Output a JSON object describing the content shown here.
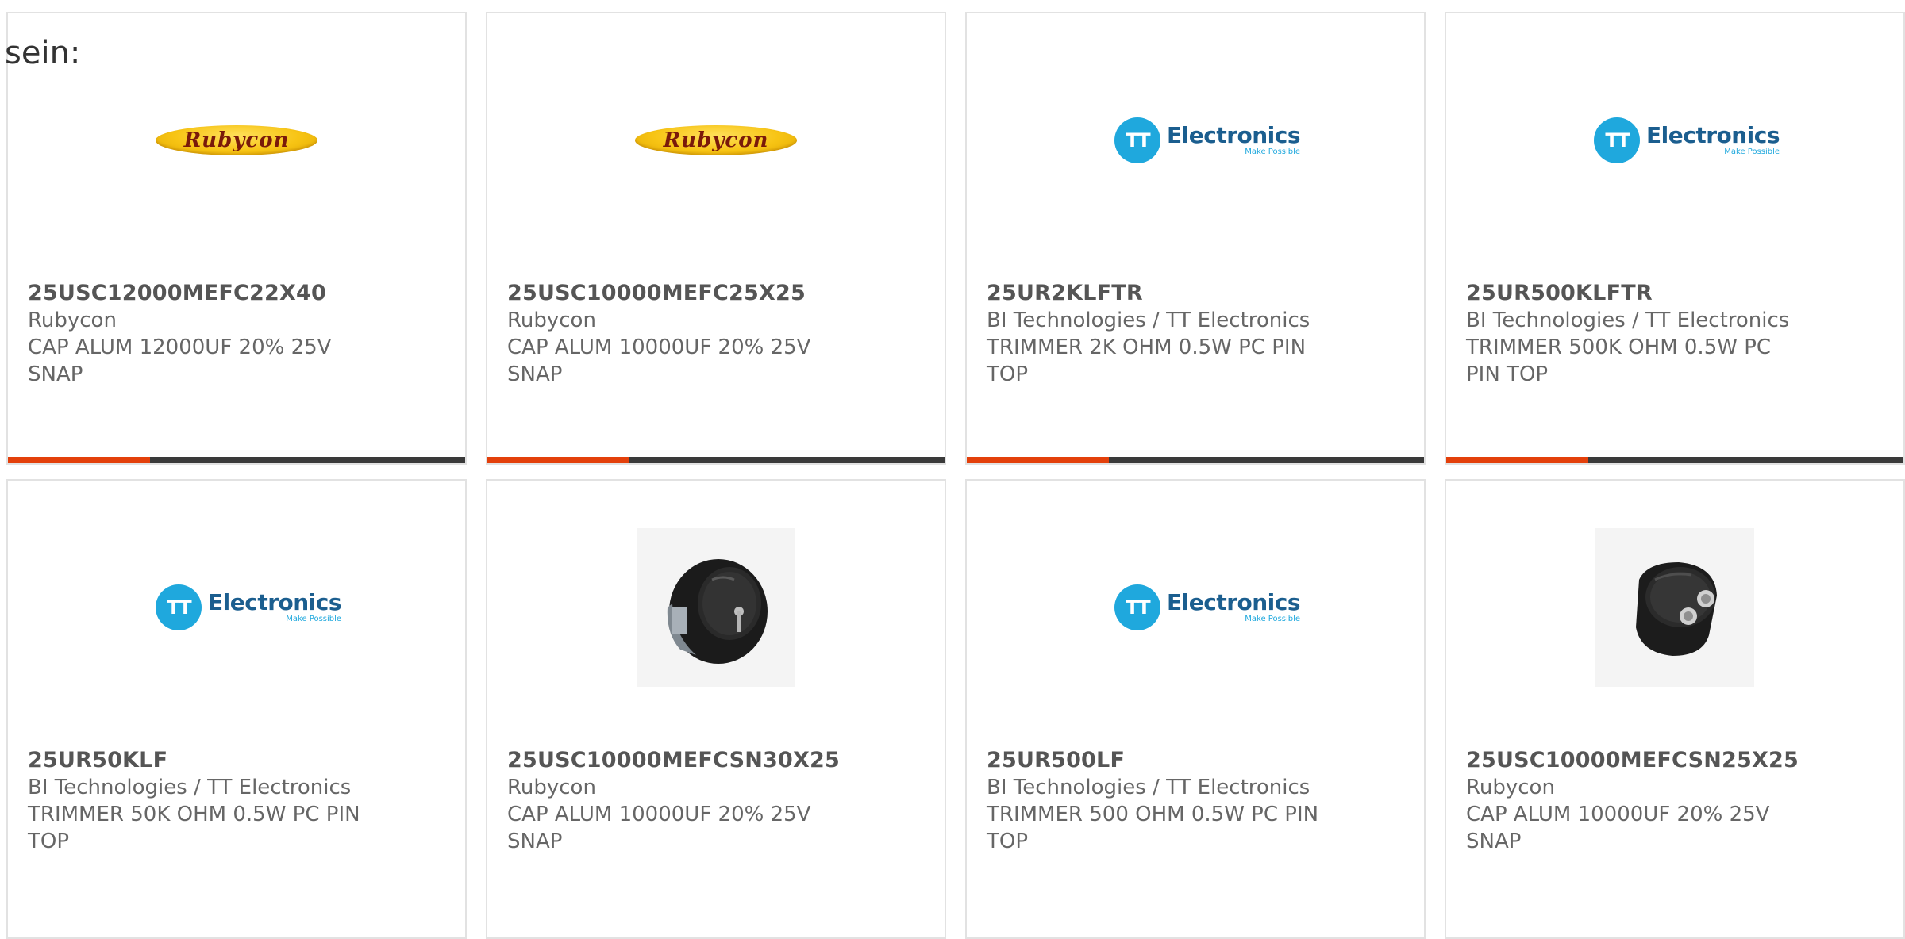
{
  "page": {
    "label": "sein:"
  },
  "colors": {
    "accent": "#e3400b",
    "bar_track": "#3a3a3a",
    "rubycon_yellow": "#f7c414",
    "tt_blue": "#1fa8dd"
  },
  "logos": {
    "rubycon": "Rubycon",
    "tt_initials": "TT",
    "tt_name": "Electronics",
    "tt_tagline": "Make Possible"
  },
  "cards": [
    {
      "part": "25USC12000MEFC22X40",
      "manufacturer": "Rubycon",
      "description": "CAP ALUM 12000UF 20% 25V SNAP",
      "image": "rubycon-logo",
      "progress": 0.31
    },
    {
      "part": "25USC10000MEFC25X25",
      "manufacturer": "Rubycon",
      "description": "CAP ALUM 10000UF 20% 25V SNAP",
      "image": "rubycon-logo",
      "progress": 0.31
    },
    {
      "part": "25UR2KLFTR",
      "manufacturer": "BI Technologies / TT Electronics",
      "description": "TRIMMER 2K OHM 0.5W PC PIN TOP",
      "image": "tt-electronics-logo",
      "progress": 0.31
    },
    {
      "part": "25UR500KLFTR",
      "manufacturer": "BI Technologies / TT Electronics",
      "description": "TRIMMER 500K OHM 0.5W PC PIN TOP",
      "image": "tt-electronics-logo",
      "progress": 0.31
    },
    {
      "part": "25UR50KLF",
      "manufacturer": "BI Technologies / TT Electronics",
      "description": "TRIMMER 50K OHM 0.5W PC PIN TOP",
      "image": "tt-electronics-logo"
    },
    {
      "part": "25USC10000MEFCSN30X25",
      "manufacturer": "Rubycon",
      "description": "CAP ALUM 10000UF 20% 25V SNAP",
      "image": "capacitor-photo-side"
    },
    {
      "part": "25UR500LF",
      "manufacturer": "BI Technologies / TT Electronics",
      "description": "TRIMMER 500 OHM 0.5W PC PIN TOP",
      "image": "tt-electronics-logo"
    },
    {
      "part": "25USC10000MEFCSN25X25",
      "manufacturer": "Rubycon",
      "description": "CAP ALUM 10000UF 20% 25V SNAP",
      "image": "capacitor-photo-top"
    }
  ]
}
